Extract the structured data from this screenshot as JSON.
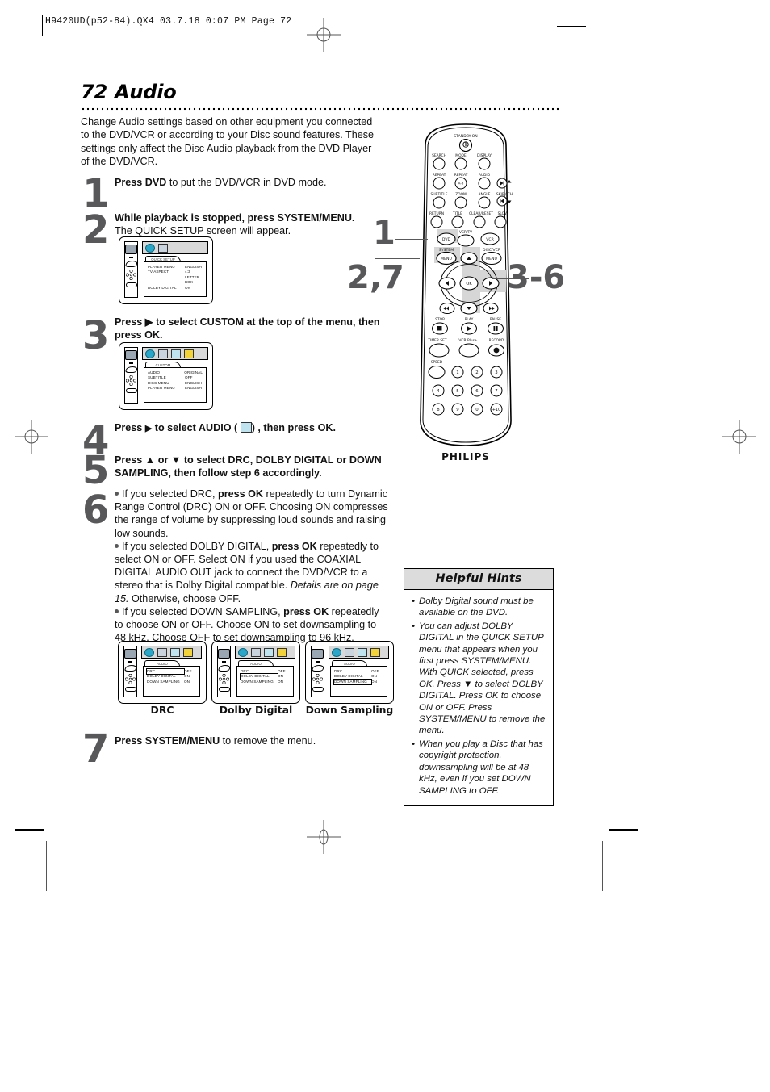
{
  "print_marks": {
    "header": "H9420UD(p52-84).QX4  03.7.18  0:07 PM  Page 72"
  },
  "page": {
    "number": "72",
    "title": "Audio",
    "intro": "Change Audio settings based on other equipment you connected to the DVD/VCR or according to your Disc sound features. These settings only affect the Disc Audio playback from the DVD Player of the DVD/VCR."
  },
  "steps": [
    {
      "number": "1",
      "bold_lead": "Press DVD",
      "rest": " to put the DVD/VCR in DVD mode."
    },
    {
      "number": "2",
      "bold_lead": "While playback is stopped, press SYSTEM/MENU.",
      "rest": "The QUICK SETUP screen will appear."
    },
    {
      "number": "3",
      "bold_lead": "Press ▶ to select CUSTOM at the top of the menu, then press OK.",
      "rest": ""
    },
    {
      "number": "4",
      "bold_lead": "Press ▶ to select AUDIO (   ) , then press OK.",
      "rest": ""
    },
    {
      "number": "5",
      "bold_lead": "Press ▲ or ▼ to select DRC, DOLBY DIGITAL or DOWN SAMPLING, then follow step 6 accordingly.",
      "rest": ""
    },
    {
      "number": "6",
      "bullets": [
        "If you selected DRC, press OK repeatedly to turn Dynamic Range Control (DRC) ON or OFF. Choosing ON compresses the range of volume by suppressing loud sounds and raising low sounds.",
        "If you selected DOLBY DIGITAL, press OK repeatedly to select ON or OFF. Select ON if you used the COAXIAL DIGITAL AUDIO OUT jack to connect the DVD/VCR to a stereo that is Dolby Digital compatible. Details are on page 15. Otherwise, choose OFF.",
        "If you selected DOWN SAMPLING, press OK repeatedly to choose ON or OFF. Choose ON to set downsampling to 48 kHz. Choose OFF to set downsampling to 96 kHz."
      ]
    },
    {
      "number": "7",
      "bold_lead": "Press SYSTEM/MENU",
      "rest": " to remove the menu."
    }
  ],
  "step6_bullets_rich": [
    {
      "a": "If you selected DRC, ",
      "b": "press OK",
      "c": " repeatedly to turn Dynamic Range Control (DRC) ON or OFF. Choosing ON compresses the range of volume by suppressing loud sounds and raising low sounds."
    },
    {
      "a": "If you selected DOLBY DIGITAL, ",
      "b": "press OK",
      "c": " repeatedly to select ON or OFF. Select ON if you used the COAXIAL DIGITAL AUDIO OUT jack to connect the DVD/VCR to a stereo that is Dolby Digital compatible. ",
      "d": "Details are on page 15.",
      "e": " Otherwise, choose OFF."
    },
    {
      "a": "If you selected DOWN SAMPLING, ",
      "b": "press OK",
      "c": " repeatedly to choose ON or OFF. Choose ON to set downsampling to 48 kHz. Choose OFF to set downsampling to 96 kHz."
    }
  ],
  "osd_screens": {
    "quick_setup": {
      "tab": "QUICK SETUP",
      "rows": [
        {
          "label": "PLAYER MENU",
          "value": "ENGLISH"
        },
        {
          "label": "TV ASPECT",
          "value": "4:3 LETTER BOX"
        },
        {
          "label": "DOLBY DIGITAL",
          "value": "ON"
        }
      ]
    },
    "custom": {
      "tab": "CUSTOM",
      "rows": [
        {
          "label": "AUDIO",
          "value": "ORIGINAL"
        },
        {
          "label": "SUBTITLE",
          "value": "OFF"
        },
        {
          "label": "DISC MENU",
          "value": "ENGLISH"
        },
        {
          "label": "PLAYER MENU",
          "value": "ENGLISH"
        }
      ]
    },
    "audio_drc": {
      "tab": "AUDIO",
      "caption": "DRC",
      "selected_index": 0,
      "rows": [
        {
          "label": "DRC",
          "value": "OFF"
        },
        {
          "label": "DOLBY DIGITAL",
          "value": "ON"
        },
        {
          "label": "DOWN SAMPLING",
          "value": "ON"
        }
      ]
    },
    "audio_dolby": {
      "tab": "AUDIO",
      "caption": "Dolby Digital",
      "selected_index": 1,
      "rows": [
        {
          "label": "DRC",
          "value": "OFF"
        },
        {
          "label": "DOLBY DIGITAL",
          "value": "ON"
        },
        {
          "label": "DOWN SAMPLING",
          "value": "ON"
        }
      ]
    },
    "audio_down": {
      "tab": "AUDIO",
      "caption": "Down Sampling",
      "selected_index": 2,
      "rows": [
        {
          "label": "DRC",
          "value": "OFF"
        },
        {
          "label": "DOLBY DIGITAL",
          "value": "ON"
        },
        {
          "label": "DOWN SAMPLING",
          "value": "ON"
        }
      ]
    }
  },
  "remote": {
    "brand": "PHILIPS",
    "standby_label": "STANDBY-ON",
    "labels_row1": [
      "SEARCH",
      "MODE",
      "DISPLAY"
    ],
    "labels_row2": [
      "REPEAT",
      "REPEAT",
      "AUDIO"
    ],
    "labels_row3": [
      "SUBTITLE",
      "ZOOM",
      "ANGLE",
      "SKIP / CH"
    ],
    "labels_row4": [
      "RETURN",
      "TITLE",
      "CLEAR/RESET",
      "SLOW"
    ],
    "zoom_ab": "A-B",
    "vcrtv": "VCR/TV",
    "dvd": "DVD",
    "vcr": "VCR",
    "system": "SYSTEM",
    "disc_vcr": "DISC/VCR",
    "menu": "MENU",
    "ok": "OK",
    "transport_labels": [
      "STOP",
      "PLAY",
      "PAUSE"
    ],
    "labels_row6": [
      "TIMER SET",
      "VCR Plus+",
      "RECORD"
    ],
    "speed": "SPEED",
    "keypad": [
      "1",
      "2",
      "3",
      "4",
      "5",
      "6",
      "7",
      "8",
      "9",
      "0",
      "+10"
    ]
  },
  "callouts": [
    {
      "id": "callout-1",
      "text": "1"
    },
    {
      "id": "callout-2-7",
      "text": "2,7"
    },
    {
      "id": "callout-3-6",
      "text": "3-6"
    }
  ],
  "helpful_hints": {
    "title": "Helpful Hints",
    "items": [
      "Dolby Digital sound must be available on the DVD.",
      "You can adjust DOLBY DIGITAL in the QUICK SETUP menu that appears when you first press SYSTEM/MENU. With QUICK selected, press OK. Press ▼ to select DOLBY DIGITAL. Press OK to choose ON or OFF. Press SYSTEM/MENU to remove the menu.",
      "When you play a Disc that has copyright protection, downsampling will be at 48 kHz, even if you set DOWN SAMPLING to OFF."
    ]
  }
}
